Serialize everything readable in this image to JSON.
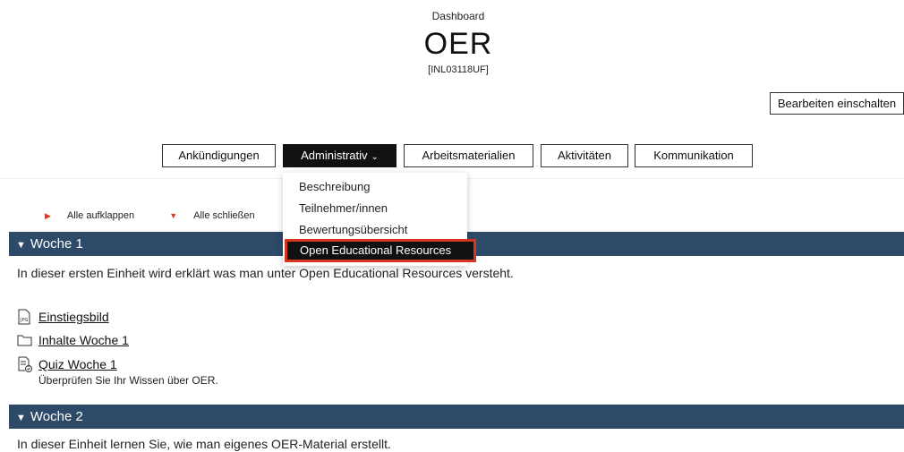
{
  "header": {
    "breadcrumb": "Dashboard",
    "title": "OER",
    "code": "[INL03118UF]",
    "edit_button": "Bearbeiten einschalten"
  },
  "nav": {
    "tabs": [
      {
        "label": "Ankündigungen"
      },
      {
        "label": "Administrativ"
      },
      {
        "label": "Arbeitsmaterialien"
      },
      {
        "label": "Aktivitäten"
      },
      {
        "label": "Kommunikation"
      }
    ],
    "active_tab": "Administrativ"
  },
  "dropdown": {
    "items": [
      "Beschreibung",
      "Teilnehmer/innen",
      "Bewertungsübersicht",
      "Open Educational Resources"
    ],
    "highlighted": "Open Educational Resources"
  },
  "controls": {
    "expand_all": "Alle aufklappen",
    "collapse_all": "Alle schließen"
  },
  "sections": [
    {
      "title": "Woche 1",
      "description": "In dieser ersten Einheit wird erklärt was man unter Open Educational Resources versteht.",
      "activities": [
        {
          "label": "Einstiegsbild",
          "icon": "jpg-file-icon"
        },
        {
          "label": "Inhalte Woche 1",
          "icon": "folder-icon"
        },
        {
          "label": "Quiz Woche 1",
          "icon": "quiz-icon",
          "subtitle": "Überprüfen Sie Ihr Wissen über OER."
        }
      ]
    },
    {
      "title": "Woche 2",
      "description": "In dieser Einheit lernen Sie, wie man eigenes OER-Material erstellt."
    }
  ],
  "colors": {
    "section_bar": "#2d4a68",
    "highlight_border": "#d7351f",
    "active_tab": "#111111",
    "triangle": "#d23a2a"
  }
}
